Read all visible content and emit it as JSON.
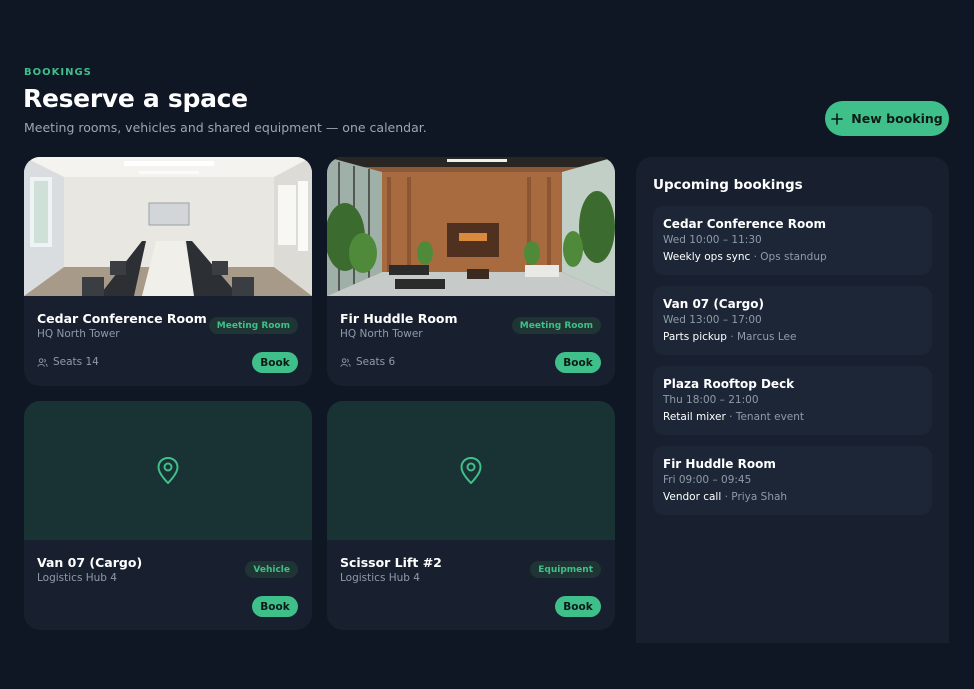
{
  "header": {
    "eyebrow": "BOOKINGS",
    "title": "Reserve a space",
    "subtitle": "Meeting rooms, vehicles and shared equipment — one calendar.",
    "new_booking_label": "New booking"
  },
  "resources": [
    {
      "name": "Cedar Conference Room",
      "location": "HQ North Tower",
      "type": "Meeting Room",
      "seats": "Seats 14",
      "book_label": "Book",
      "media": "conference-room-photo"
    },
    {
      "name": "Fir Huddle Room",
      "location": "HQ North Tower",
      "type": "Meeting Room",
      "seats": "Seats 6",
      "book_label": "Book",
      "media": "lobby-photo"
    },
    {
      "name": "Van 07 (Cargo)",
      "location": "Logistics Hub 4",
      "type": "Vehicle",
      "book_label": "Book",
      "media": "map-pin-icon"
    },
    {
      "name": "Scissor Lift #2",
      "location": "Logistics Hub 4",
      "type": "Equipment",
      "book_label": "Book",
      "media": "map-pin-icon"
    }
  ],
  "upcoming": {
    "title": "Upcoming bookings",
    "items": [
      {
        "name": "Cedar Conference Room",
        "time": "Wed 10:00 – 11:30",
        "purpose": "Weekly ops sync",
        "sep": " · ",
        "sub": "Ops standup"
      },
      {
        "name": "Van 07 (Cargo)",
        "time": "Wed 13:00 – 17:00",
        "purpose": "Parts pickup",
        "sep": " · ",
        "sub": "Marcus Lee"
      },
      {
        "name": "Plaza Rooftop Deck",
        "time": "Thu 18:00 – 21:00",
        "purpose": "Retail mixer",
        "sep": " · ",
        "sub": "Tenant event"
      },
      {
        "name": "Fir Huddle Room",
        "time": "Fri 09:00 – 09:45",
        "purpose": "Vendor call",
        "sep": " · ",
        "sub": "Priya Shah"
      }
    ]
  },
  "colors": {
    "background": "#0f1724",
    "card": "#18202f",
    "accent": "#3fbf8a",
    "tag_bg": "#1e3533",
    "placeholder_bg": "#193234"
  }
}
